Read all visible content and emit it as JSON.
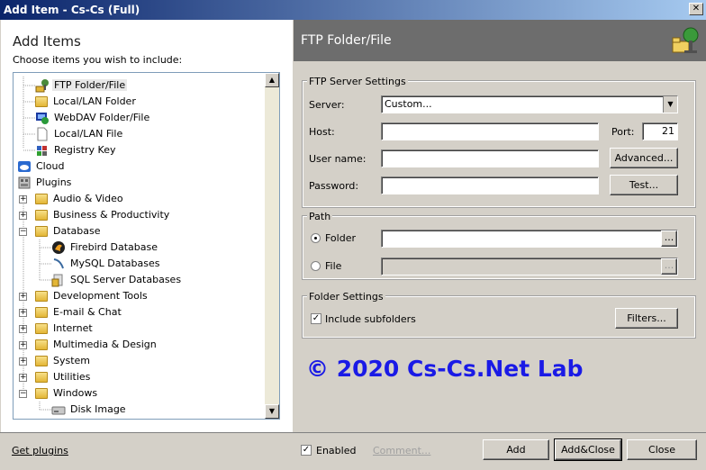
{
  "window": {
    "title": "Add Item - Cs-Cs (Full)",
    "close_glyph": "✕"
  },
  "left": {
    "title": "Add Items",
    "subtitle": "Choose items you wish to include:",
    "tree": [
      {
        "label": "FTP Folder/File",
        "icon": "ftp-icon",
        "selected": true
      },
      {
        "label": "Local/LAN Folder",
        "icon": "folder-icon"
      },
      {
        "label": "WebDAV Folder/File",
        "icon": "webdav-icon"
      },
      {
        "label": "Local/LAN File",
        "icon": "file-icon"
      },
      {
        "label": "Registry Key",
        "icon": "registry-icon"
      },
      {
        "label": "Cloud",
        "icon": "cloud-icon"
      },
      {
        "label": "Plugins",
        "icon": "plugins-icon"
      },
      {
        "label": "Audio & Video",
        "icon": "folder-icon",
        "expander": "+"
      },
      {
        "label": "Business & Productivity",
        "icon": "folder-icon",
        "expander": "+"
      },
      {
        "label": "Database",
        "icon": "folder-icon",
        "expander": "−"
      },
      {
        "label": "Firebird Database",
        "icon": "firebird-icon"
      },
      {
        "label": "MySQL Databases",
        "icon": "mysql-icon"
      },
      {
        "label": "SQL Server Databases",
        "icon": "sqlserver-icon"
      },
      {
        "label": "Development Tools",
        "icon": "folder-icon",
        "expander": "+"
      },
      {
        "label": "E-mail & Chat",
        "icon": "folder-icon",
        "expander": "+"
      },
      {
        "label": "Internet",
        "icon": "folder-icon",
        "expander": "+"
      },
      {
        "label": "Multimedia & Design",
        "icon": "folder-icon",
        "expander": "+"
      },
      {
        "label": "System",
        "icon": "folder-icon",
        "expander": "+"
      },
      {
        "label": "Utilities",
        "icon": "folder-icon",
        "expander": "+"
      },
      {
        "label": "Windows",
        "icon": "folder-icon",
        "expander": "−"
      },
      {
        "label": "Disk Image",
        "icon": "disk-image-icon"
      }
    ]
  },
  "right": {
    "header_title": "FTP Folder/File",
    "ftp_group": {
      "title": "FTP Server Settings",
      "server_label": "Server:",
      "server_value": "Custom...",
      "host_label": "Host:",
      "host_value": "",
      "port_label": "Port:",
      "port_value": "21",
      "user_label": "User name:",
      "user_value": "",
      "password_label": "Password:",
      "password_value": "",
      "advanced_button": "Advanced...",
      "test_button": "Test..."
    },
    "path_group": {
      "title": "Path",
      "folder_label": "Folder",
      "folder_value": "",
      "file_label": "File",
      "file_value": "",
      "browse_label": "..."
    },
    "folder_settings": {
      "title": "Folder Settings",
      "include_subfolders_label": "Include subfolders",
      "include_subfolders_checked": true,
      "filters_button": "Filters..."
    },
    "copyright": "© 2020 Cs-Cs.Net Lab"
  },
  "bottom": {
    "get_plugins": "Get plugins",
    "enabled_label": "Enabled",
    "comment_link": "Comment...",
    "add_button": "Add",
    "add_close_button": "Add&Close",
    "close_button": "Close"
  },
  "colors": {
    "header_bg": "#6d6d6d",
    "copyright": "#1a1ae6",
    "title_bar": "#0a246a"
  }
}
